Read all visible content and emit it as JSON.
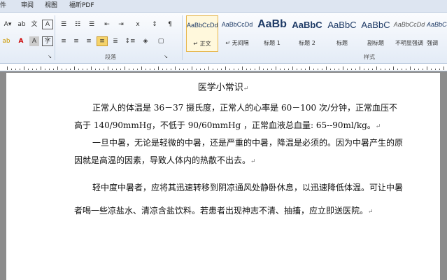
{
  "tabs": [
    "件",
    "审阅",
    "视图",
    "福昕PDF"
  ],
  "ribbon": {
    "font": {
      "size_label": "A",
      "bold_label": "A"
    },
    "paragraph_label": "段落",
    "styles_label": "样式",
    "styles": [
      {
        "preview": "AaBbCcDd",
        "name": "↵ 正文"
      },
      {
        "preview": "AaBbCcDd",
        "name": "↵ 无间隔"
      },
      {
        "preview": "AaBb",
        "name": "标题 1"
      },
      {
        "preview": "AaBbC",
        "name": "标题 2"
      },
      {
        "preview": "AaBbC",
        "name": "标题"
      },
      {
        "preview": "AaBbC",
        "name": "副标题"
      },
      {
        "preview": "AaBbCcDd",
        "name": "不明显强调"
      },
      {
        "preview": "AaBbCcDd",
        "name": "强调"
      }
    ]
  },
  "document": {
    "title": "医学小常识",
    "paragraphs": [
      "正常人的体温是 36－37 摄氏度，正常人的心率是 60－100 次/分钟，正常血压不高于 140/90mmHg，不低于 90/60mmHg ，正常血液总血量:   65--90ml/kg。",
      "一旦中暑，无论是轻微的中暑，还是严重的中暑，降温是必须的。因为中暑产生的原因就是高温的因素，导致人体内的热散不出去。",
      "轻中度中暑者，应将其迅速转移到阴凉通风处静卧休息，以迅速降低体温。可让中暑者喝一些凉盐水、清凉含盐饮料。若患者出现神志不清、抽搐，应立即送医院。"
    ],
    "para_marks": [
      "↵",
      "↵",
      "↵",
      "↵"
    ]
  }
}
